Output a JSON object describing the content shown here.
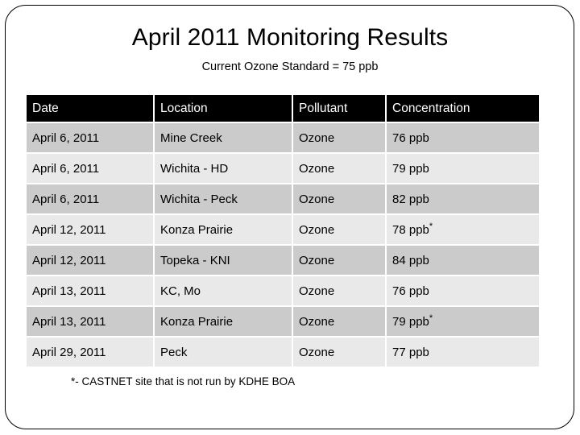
{
  "slide": {
    "title": "April 2011 Monitoring Results",
    "subtitle": "Current Ozone Standard = 75 ppb",
    "footnote": "*- CASTNET site that is not run by KDHE BOA",
    "colors": {
      "header_background": "#000000",
      "header_text": "#ffffff",
      "row_shade_dark": "#cbcbcb",
      "row_shade_light": "#e9e9e9",
      "page_background": "#ffffff",
      "border": "#000000",
      "text": "#000000"
    }
  },
  "table": {
    "columns": [
      "Date",
      "Location",
      "Pollutant",
      "Concentration"
    ],
    "rows": [
      {
        "date": "April 6, 2011",
        "location": "Mine Creek",
        "pollutant": "Ozone",
        "concentration": "76 ppb",
        "footnote_mark": ""
      },
      {
        "date": "April 6, 2011",
        "location": "Wichita - HD",
        "pollutant": "Ozone",
        "concentration": "79 ppb",
        "footnote_mark": ""
      },
      {
        "date": "April 6, 2011",
        "location": "Wichita - Peck",
        "pollutant": "Ozone",
        "concentration": "82 ppb",
        "footnote_mark": ""
      },
      {
        "date": "April 12, 2011",
        "location": "Konza Prairie",
        "pollutant": "Ozone",
        "concentration": "78 ppb",
        "footnote_mark": "*"
      },
      {
        "date": "April 12, 2011",
        "location": "Topeka - KNI",
        "pollutant": "Ozone",
        "concentration": "84 ppb",
        "footnote_mark": ""
      },
      {
        "date": "April 13, 2011",
        "location": "KC, Mo",
        "pollutant": "Ozone",
        "concentration": "76 ppb",
        "footnote_mark": ""
      },
      {
        "date": "April 13, 2011",
        "location": "Konza Prairie",
        "pollutant": "Ozone",
        "concentration": "79 ppb",
        "footnote_mark": "*"
      },
      {
        "date": "April 29, 2011",
        "location": "Peck",
        "pollutant": "Ozone",
        "concentration": "77 ppb",
        "footnote_mark": ""
      }
    ]
  }
}
